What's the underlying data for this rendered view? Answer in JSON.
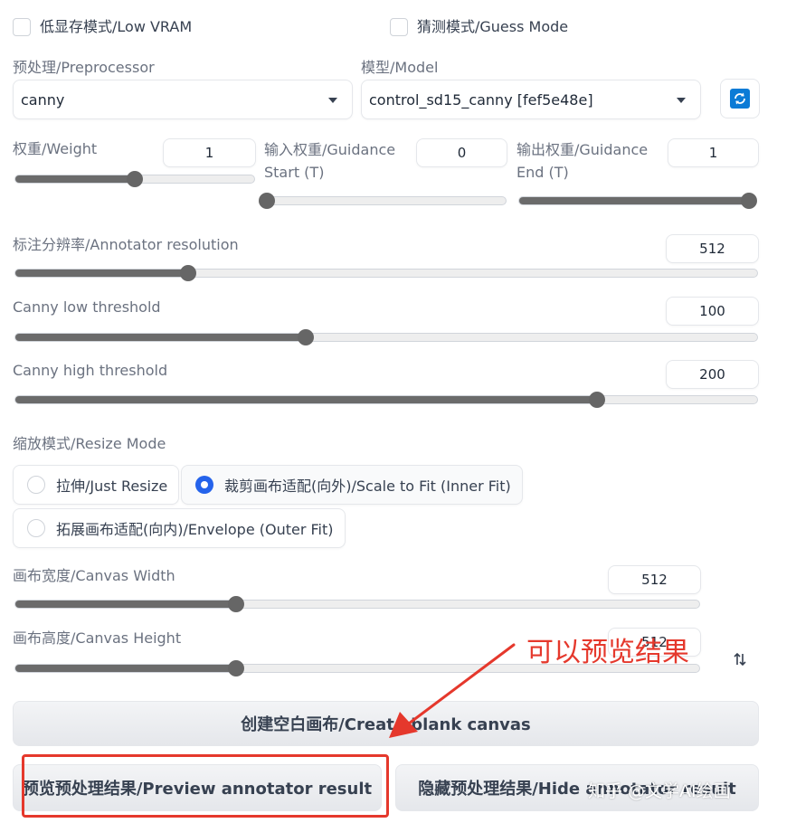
{
  "options": {
    "low_vram_label": "低显存模式/Low VRAM",
    "guess_mode_label": "猜测模式/Guess Mode"
  },
  "preprocessor": {
    "label": "预处理/Preprocessor",
    "value": "canny"
  },
  "model": {
    "label": "模型/Model",
    "value": "control_sd15_canny [fef5e48e]"
  },
  "weight": {
    "label": "权重/Weight",
    "value": "1",
    "fraction": 0.5
  },
  "guidance_start": {
    "label": "输入权重/Guidance Start (T)",
    "value": "0",
    "fraction": 0.0
  },
  "guidance_end": {
    "label": "输出权重/Guidance End (T)",
    "value": "1",
    "fraction": 1.0
  },
  "annotator_resolution": {
    "label": "标注分辨率/Annotator resolution",
    "value": "512",
    "fraction": 0.233
  },
  "canny_low": {
    "label": "Canny low threshold",
    "value": "100",
    "fraction": 0.392
  },
  "canny_high": {
    "label": "Canny high threshold",
    "value": "200",
    "fraction": 0.784
  },
  "resize_mode": {
    "label": "缩放模式/Resize Mode",
    "options": [
      {
        "label": "拉伸/Just Resize",
        "selected": false
      },
      {
        "label": "裁剪画布适配(向外)/Scale to Fit (Inner Fit)",
        "selected": true
      },
      {
        "label": "拓展画布适配(向内)/Envelope (Outer Fit)",
        "selected": false
      }
    ]
  },
  "canvas_width": {
    "label": "画布宽度/Canvas Width",
    "value": "512",
    "fraction": 0.323
  },
  "canvas_height": {
    "label": "画布高度/Canvas Height",
    "value": "512",
    "fraction": 0.323
  },
  "buttons": {
    "create_blank_canvas": "创建空白画布/Create blank canvas",
    "preview_annotator": "预览预处理结果/Preview annotator result",
    "hide_annotator": "隐藏预处理结果/Hide annotator result"
  },
  "icons": {
    "refresh": "refresh-icon",
    "swap": "swap-icon"
  },
  "annotation": {
    "text": "可以预览结果",
    "color": "#e5382c"
  },
  "watermark": "知乎 @文学AI绘画"
}
